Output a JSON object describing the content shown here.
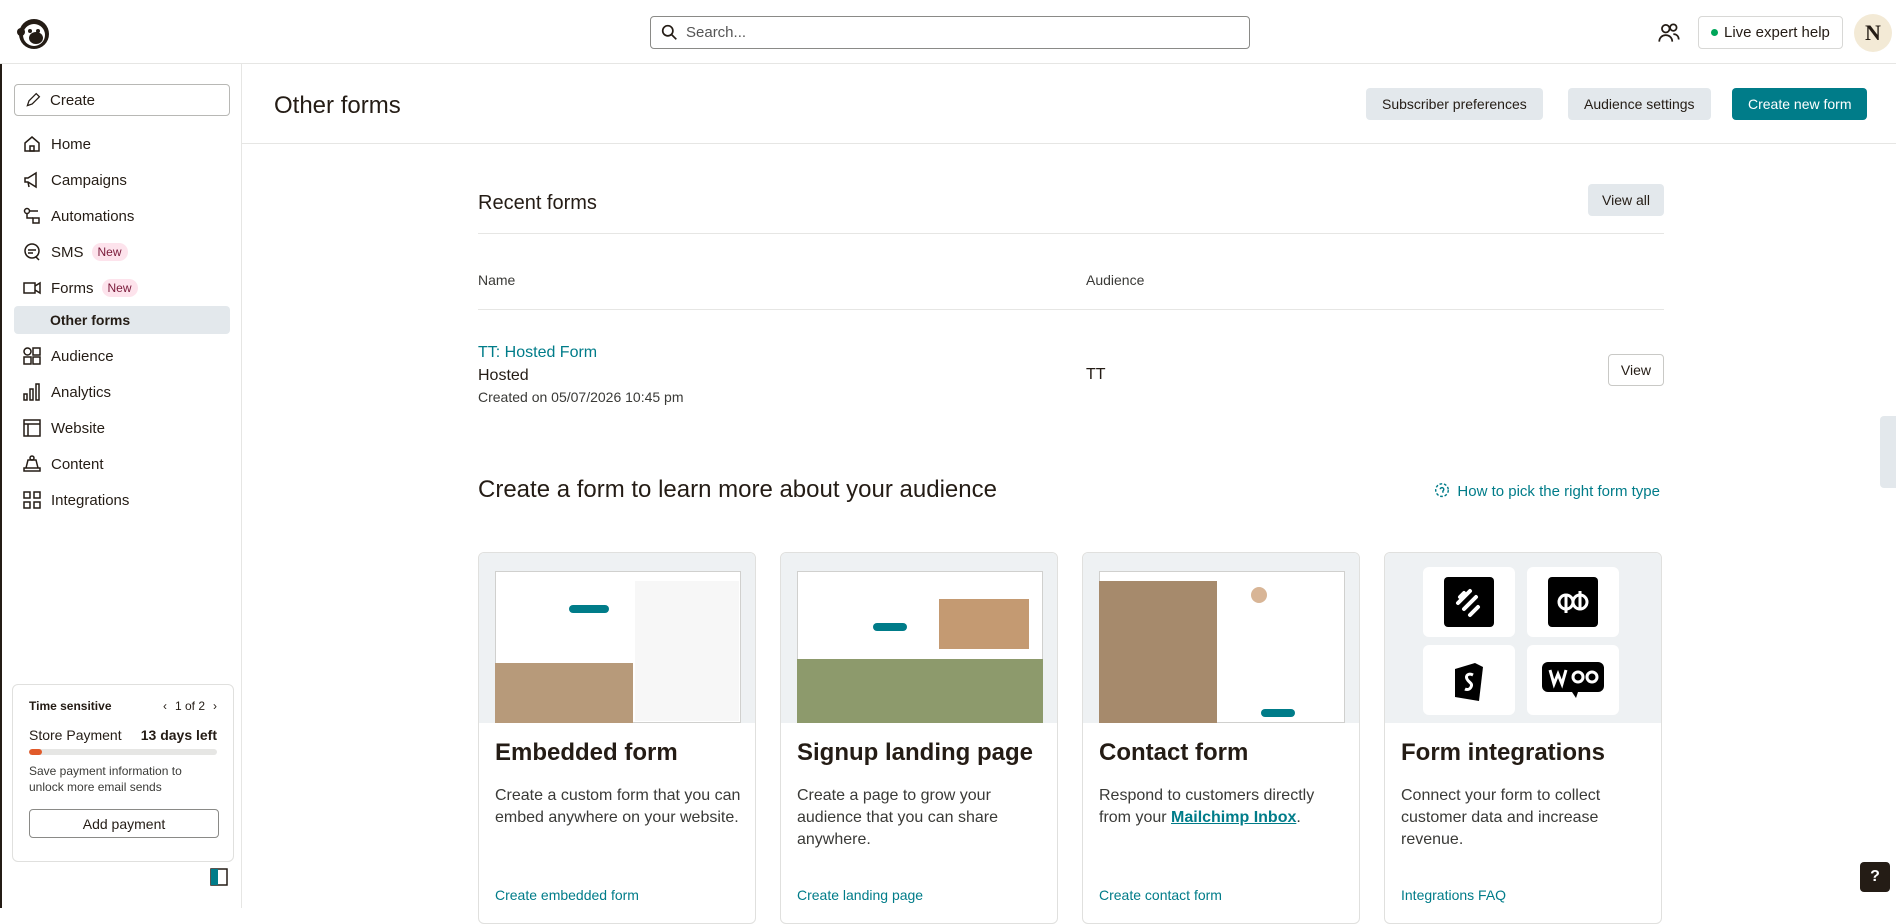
{
  "topbar": {
    "search_placeholder": "Search...",
    "live_help_label": "Live expert help",
    "avatar_initial": "N"
  },
  "sidebar": {
    "create_label": "Create",
    "items": [
      {
        "label": "Home",
        "icon": "home-icon"
      },
      {
        "label": "Campaigns",
        "icon": "megaphone-icon"
      },
      {
        "label": "Automations",
        "icon": "automation-icon"
      },
      {
        "label": "SMS",
        "icon": "sms-icon",
        "badge": "New"
      },
      {
        "label": "Forms",
        "icon": "forms-icon",
        "badge": "New"
      },
      {
        "label": "Audience",
        "icon": "audience-icon"
      },
      {
        "label": "Analytics",
        "icon": "analytics-icon"
      },
      {
        "label": "Website",
        "icon": "website-icon"
      },
      {
        "label": "Content",
        "icon": "content-icon"
      },
      {
        "label": "Integrations",
        "icon": "integrations-icon"
      }
    ],
    "sub_item": "Other forms",
    "time_sensitive": {
      "heading": "Time sensitive",
      "pager": "1 of 2",
      "title": "Store Payment",
      "days_left": "13 days left",
      "progress_fraction": 0.07,
      "description": "Save payment information to unlock more email sends",
      "button": "Add payment"
    }
  },
  "header": {
    "title": "Other forms",
    "subscriber_preferences": "Subscriber preferences",
    "audience_settings": "Audience settings",
    "create_new_form": "Create new form"
  },
  "recent": {
    "title": "Recent forms",
    "view_all": "View all",
    "col_name": "Name",
    "col_audience": "Audience",
    "rows": [
      {
        "name": "TT: Hosted Form",
        "type": "Hosted",
        "created": "Created on 05/07/2026 10:45 pm",
        "audience": "TT",
        "action": "View"
      }
    ]
  },
  "create_section": {
    "title": "Create a form to learn more about your audience",
    "how_link": "How to pick the right form type",
    "cards": [
      {
        "title": "Embedded form",
        "desc": "Create a custom form that you can embed anywhere on your website.",
        "link": "Create embedded form"
      },
      {
        "title": "Signup landing page",
        "desc": "Create a page to grow your audience that you can share anywhere.",
        "link": "Create landing page"
      },
      {
        "title": "Contact form",
        "desc_before": "Respond to customers directly from your ",
        "desc_link": "Mailchimp Inbox",
        "desc_after": ".",
        "link": "Create contact form"
      },
      {
        "title": "Form integrations",
        "desc": "Connect your form to collect customer data and increase revenue.",
        "link": "Integrations FAQ"
      }
    ]
  },
  "colors": {
    "teal": "#007c89",
    "gray_btn": "#e3e8ec",
    "progress": "#e15a2a"
  },
  "help_label": "?"
}
